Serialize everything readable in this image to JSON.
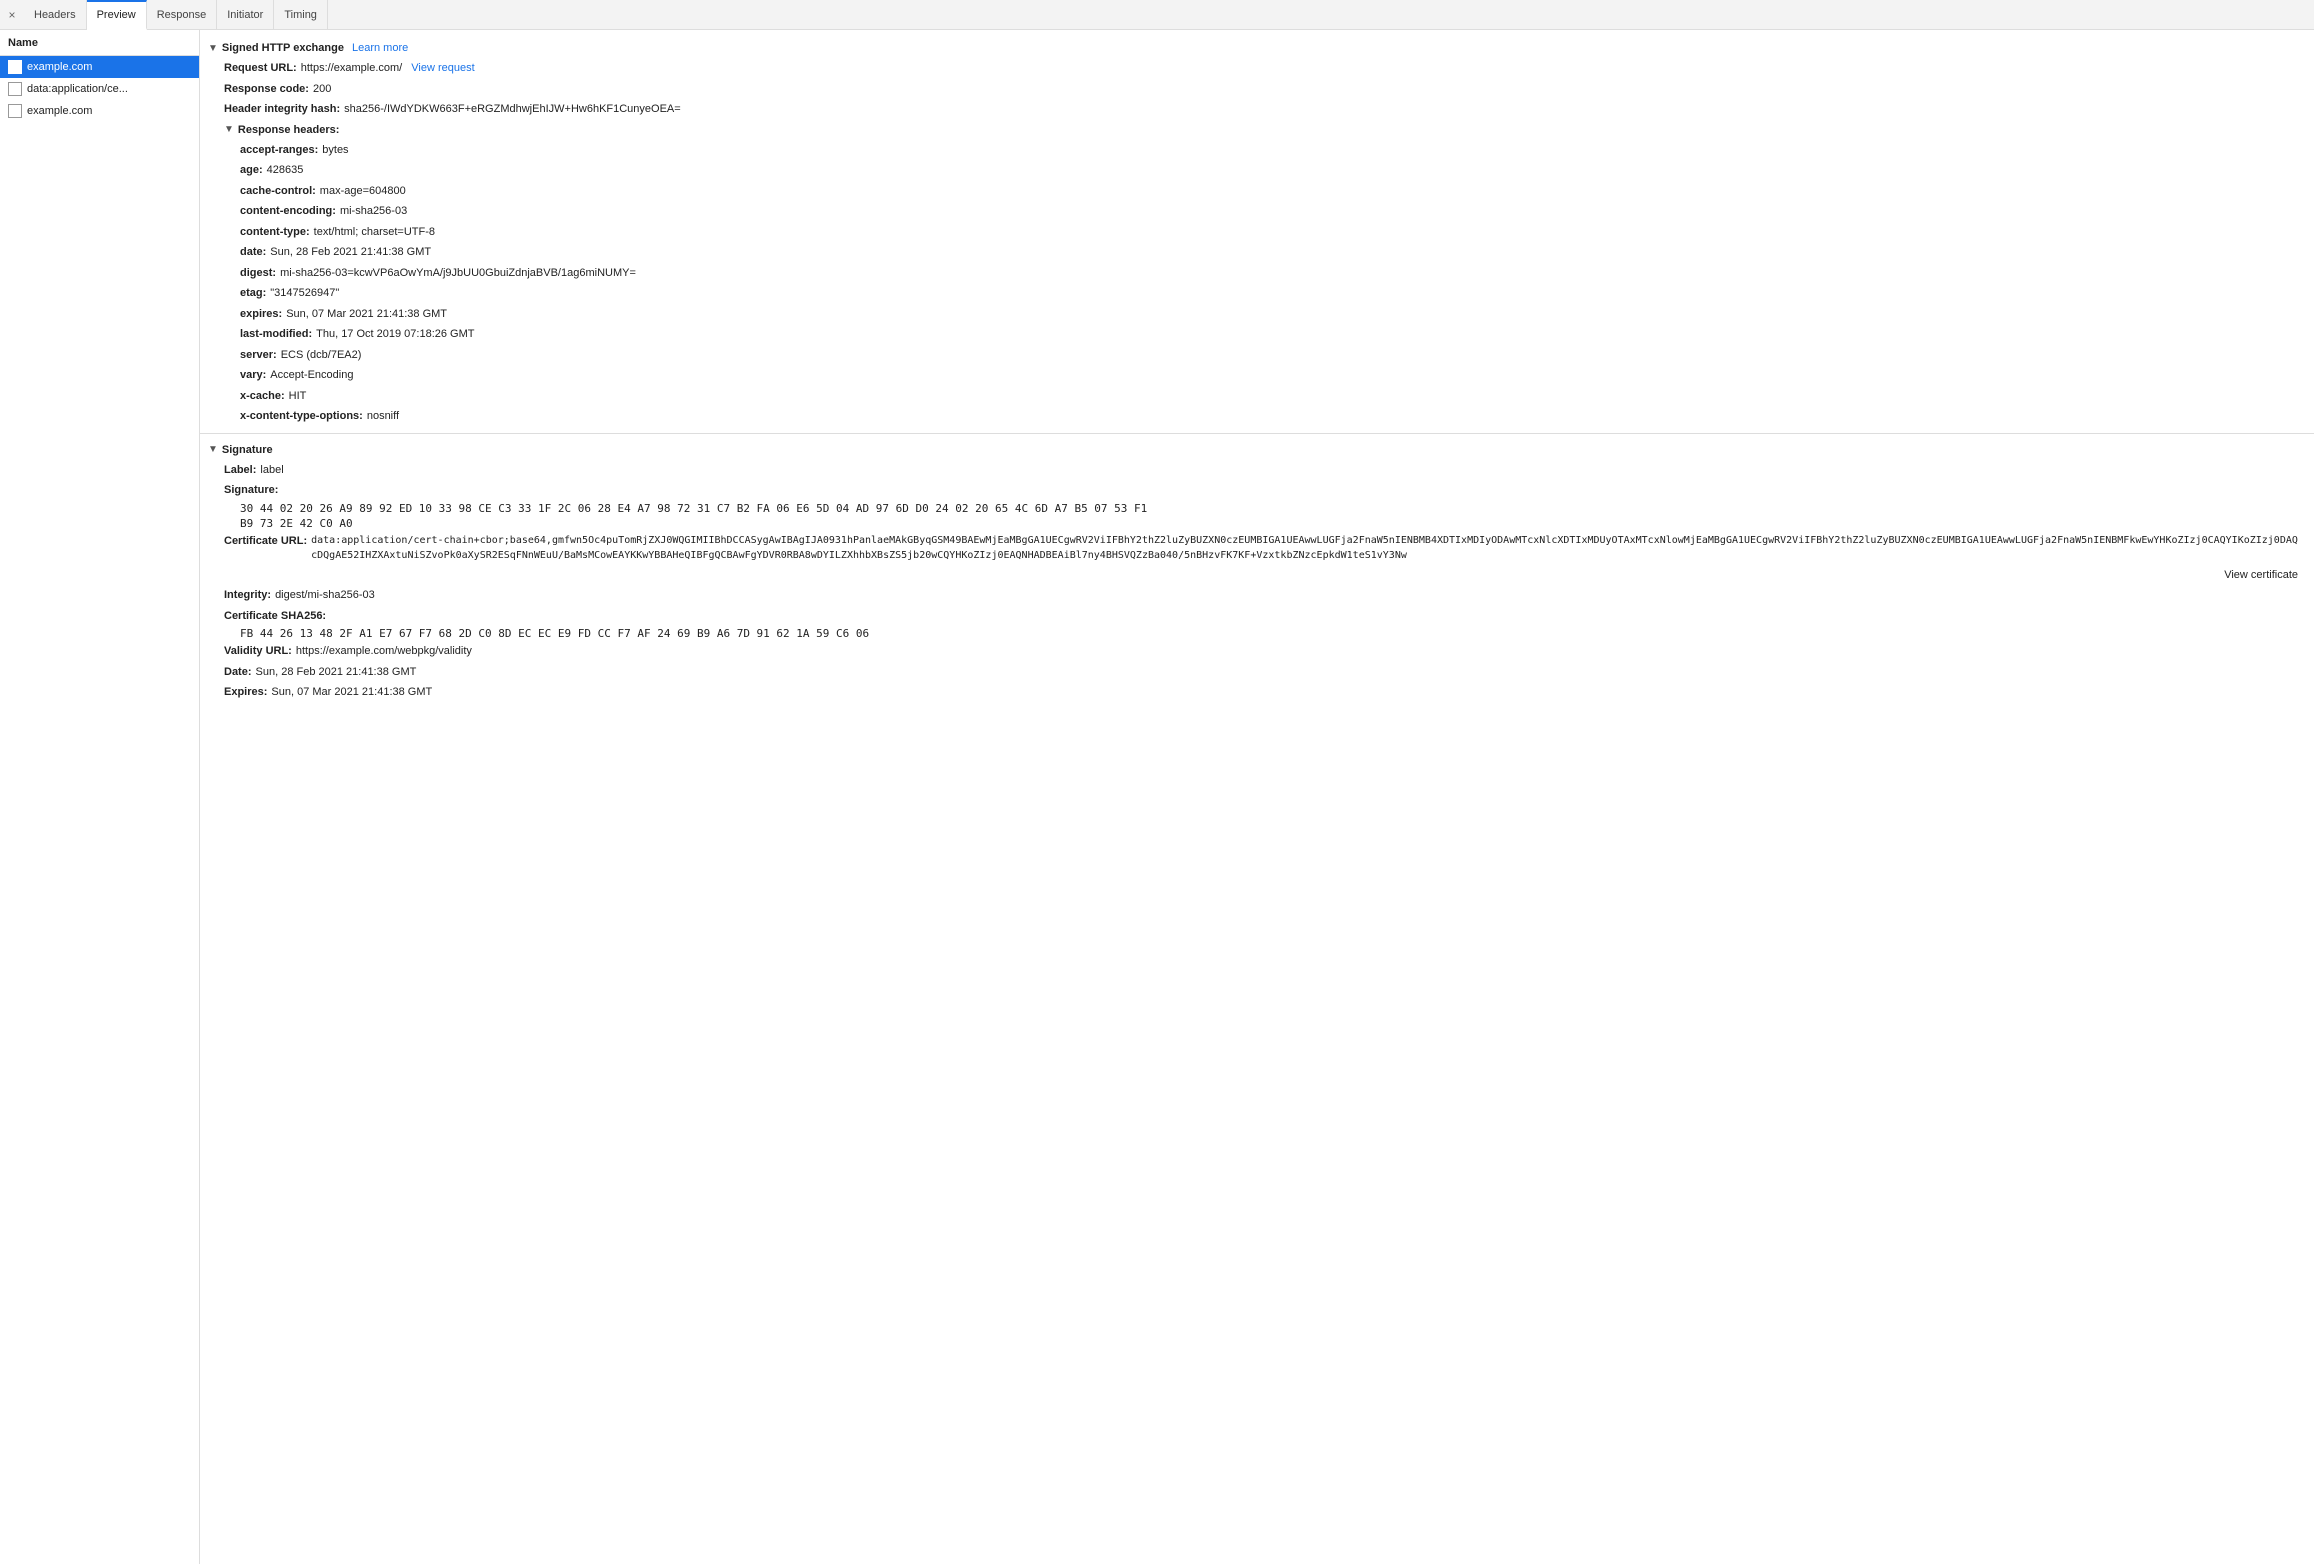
{
  "tabs": {
    "items": [
      {
        "label": "×",
        "id": "close"
      },
      {
        "label": "Headers",
        "id": "headers"
      },
      {
        "label": "Preview",
        "id": "preview",
        "active": true
      },
      {
        "label": "Response",
        "id": "response"
      },
      {
        "label": "Initiator",
        "id": "initiator"
      },
      {
        "label": "Timing",
        "id": "timing"
      }
    ]
  },
  "sidebar": {
    "header": "Name",
    "items": [
      {
        "label": "example.com",
        "selected": true
      },
      {
        "label": "data:application/ce...",
        "selected": false
      },
      {
        "label": "example.com",
        "selected": false
      }
    ]
  },
  "content": {
    "signed_exchange": {
      "title": "Signed HTTP exchange",
      "learn_more": "Learn more",
      "request_url_label": "Request URL:",
      "request_url_value": "https://example.com/",
      "view_request_label": "View request",
      "response_code_label": "Response code:",
      "response_code_value": "200",
      "header_integrity_label": "Header integrity hash:",
      "header_integrity_value": "sha256-/IWdYDKW663F+eRGZMdhwjEhIJW+Hw6hKF1CunyeOEA=",
      "response_headers_title": "Response headers:",
      "response_headers": [
        {
          "label": "accept-ranges:",
          "value": "bytes"
        },
        {
          "label": "age:",
          "value": "428635"
        },
        {
          "label": "cache-control:",
          "value": "max-age=604800"
        },
        {
          "label": "content-encoding:",
          "value": "mi-sha256-03"
        },
        {
          "label": "content-type:",
          "value": "text/html; charset=UTF-8"
        },
        {
          "label": "date:",
          "value": "Sun, 28 Feb 2021 21:41:38 GMT"
        },
        {
          "label": "digest:",
          "value": "mi-sha256-03=kcwVP6aOwYmA/j9JbUU0GbuiZdnjaBVB/1ag6miNUMY="
        },
        {
          "label": "etag:",
          "value": "\"3147526947\""
        },
        {
          "label": "expires:",
          "value": "Sun, 07 Mar 2021 21:41:38 GMT"
        },
        {
          "label": "last-modified:",
          "value": "Thu, 17 Oct 2019 07:18:26 GMT"
        },
        {
          "label": "server:",
          "value": "ECS (dcb/7EA2)"
        },
        {
          "label": "vary:",
          "value": "Accept-Encoding"
        },
        {
          "label": "x-cache:",
          "value": "HIT"
        },
        {
          "label": "x-content-type-options:",
          "value": "nosniff"
        }
      ]
    },
    "signature": {
      "title": "Signature",
      "label_label": "Label:",
      "label_value": "label",
      "signature_label": "Signature:",
      "signature_hex1": "30 44 02 20 26 A9 89 92 ED 10 33 98 CE C3 33 1F 2C 06 28 E4 A7 98 72 31 C7 B2 FA 06 E6 5D 04 AD 97 6D D0 24 02 20 65 4C 6D A7 B5 07 53 F1",
      "signature_hex2": "B9 73 2E 42 C0 A0",
      "cert_url_label": "Certificate URL:",
      "cert_url_value": "data:application/cert-chain+cbor;base64,gmfwn5Oc4puTomRjZXJ0WQGIMIIBhDCCASygAwIBAgIJA0931hPanlaeMAkGByqGSM49BAEwMjEaMBgGA1UECgwRV2ViIFBhY2thZ2luZyBUZXN0czEUMBIGA1UEAwwLUGFja2FnaW5nIENBMB4XDTIxMDIyODAwMTcxNlcXDTIxMDUyOTAxMTcxNlowMjEaMBgGA1UECgwRV2ViIFBhY2thZ2luZyBUZXN0czEUMBIGA1UEAwwLUGFja2FnaW5nIENBMFkwEwYHKoZIzj0CAQYIKoZIzj0DAQcDQgAE52IHZXAxtuNiSZvoPk0aXySR2ESqFNnWEuU/BaMsMCowEAYKKwYBBAHeQIBFgQCBAwFgYDVR0RBA8wDYILZXhhbXBsZS5jb20wCQYHKoZIzj0EAQNHADBEAiBl7ny4BHSVQZzBa040/5nBHzvFK7KF+VzxtkbZNzcEpkdW1teS1vY3Nw",
      "view_certificate_label": "View certificate",
      "integrity_label": "Integrity:",
      "integrity_value": "digest/mi-sha256-03",
      "cert_sha256_label": "Certificate SHA256:",
      "cert_sha256_value": "FB 44 26 13 48 2F A1 E7 67 F7 68 2D C0 8D EC EC E9 FD CC F7 AF 24 69 B9 A6 7D 91 62 1A 59 C6 06",
      "validity_url_label": "Validity URL:",
      "validity_url_value": "https://example.com/webpkg/validity",
      "date_label": "Date:",
      "date_value": "Sun, 28 Feb 2021 21:41:38 GMT",
      "expires_label": "Expires:",
      "expires_value": "Sun, 07 Mar 2021 21:41:38 GMT"
    }
  }
}
